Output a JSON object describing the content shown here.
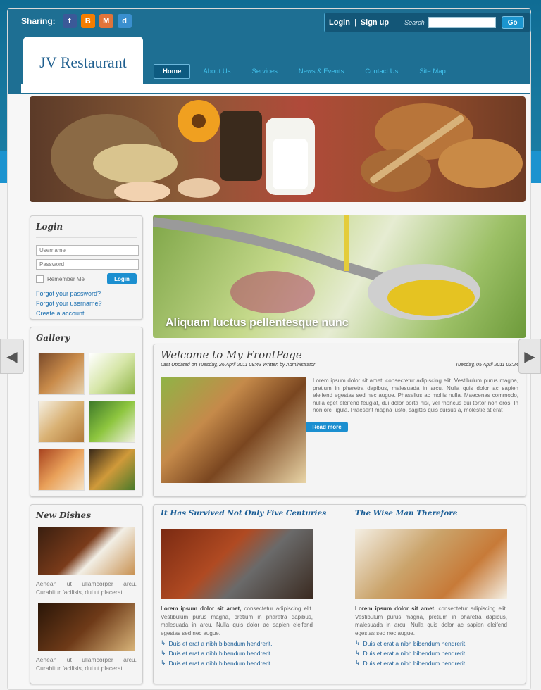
{
  "header": {
    "sharing_label": "Sharing:",
    "share_icons": [
      "facebook-icon",
      "blogger-icon",
      "myspace-icon",
      "digg-icon"
    ],
    "login_link": "Login",
    "separator": "|",
    "signup_link": "Sign up",
    "search_label": "Search",
    "search_value": "",
    "go_button": "Go"
  },
  "logo": {
    "text": "JV Restaurant"
  },
  "nav": {
    "items": [
      {
        "label": "Home",
        "active": true
      },
      {
        "label": "About Us"
      },
      {
        "label": "Services"
      },
      {
        "label": "News & Events"
      },
      {
        "label": "Contact Us"
      },
      {
        "label": "Site Map"
      }
    ]
  },
  "login_module": {
    "title": "Login",
    "username_placeholder": "Username",
    "password_placeholder": "Password",
    "remember_label": "Remember Me",
    "login_button": "Login",
    "forgot_password": "Forgot your password?",
    "forgot_username": "Forgot your username?",
    "create_account": "Create a account"
  },
  "gallery": {
    "title": "Gallery"
  },
  "new_dishes": {
    "title": "New Dishes",
    "items": [
      {
        "text": "Aenean ut ullamcorper arcu. Curabitur facilisis, dui ut placerat"
      },
      {
        "text": "Aenean ut ullamcorper arcu. Curabitur facilisis, dui ut placerat"
      }
    ]
  },
  "feature": {
    "caption": "Aliquam luctus pellentesque nunc"
  },
  "welcome": {
    "title": "Welcome to My FrontPage",
    "meta_left": "Last Updated on Tuesday, 26 April 2011 09:43 Written by Administrator",
    "meta_right": "Tuesday, 05 April 2011 03:24",
    "body": "Lorem ipsum dolor sit amet, consectetur adipiscing elit. Vestibulum purus magna, pretium in pharetra dapibus, malesuada in arcu. Nulla quis dolor ac sapien eleifend egestas sed nec augue. Phasellus ac mollis nulla. Maecenas commodo, nulla eget eleifend feugiat, dui dolor porta nisi, vel rhoncus dui tortor non eros. In non orci ligula. Praesent magna justo, sagittis quis cursus a, molestie at erat",
    "read_more": "Read more"
  },
  "articles": [
    {
      "title": "It Has Survived Not Only Five Centuries",
      "lead": "Lorem ipsum dolor sit amet,",
      "body": " consectetur adipiscing elit. Vestibulum purus magna, pretium in pharetra dapibus, malesuada in arcu. Nulla quis dolor ac sapien eleifend egestas sed nec augue.",
      "bullets": [
        "Duis et erat a nibh bibendum hendrerit.",
        "Duis et erat a nibh bibendum hendrerit.",
        "Duis et erat a nibh bibendum hendrerit."
      ]
    },
    {
      "title": "The Wise Man Therefore",
      "lead": "Lorem ipsum dolor sit amet,",
      "body": " consectetur adipiscing elit. Vestibulum purus magna, pretium in pharetra dapibus, malesuada in arcu. Nulla quis dolor ac sapien eleifend egestas sed nec augue.",
      "bullets": [
        "Duis et erat a nibh bibendum hendrerit.",
        "Duis et erat a nibh bibendum hendrerit.",
        "Duis et erat a nibh bibendum hendrerit."
      ]
    }
  ],
  "colors": {
    "header_blue": "#17779e",
    "accent_blue": "#1b8fd0",
    "nav_text": "#43c3ee"
  }
}
